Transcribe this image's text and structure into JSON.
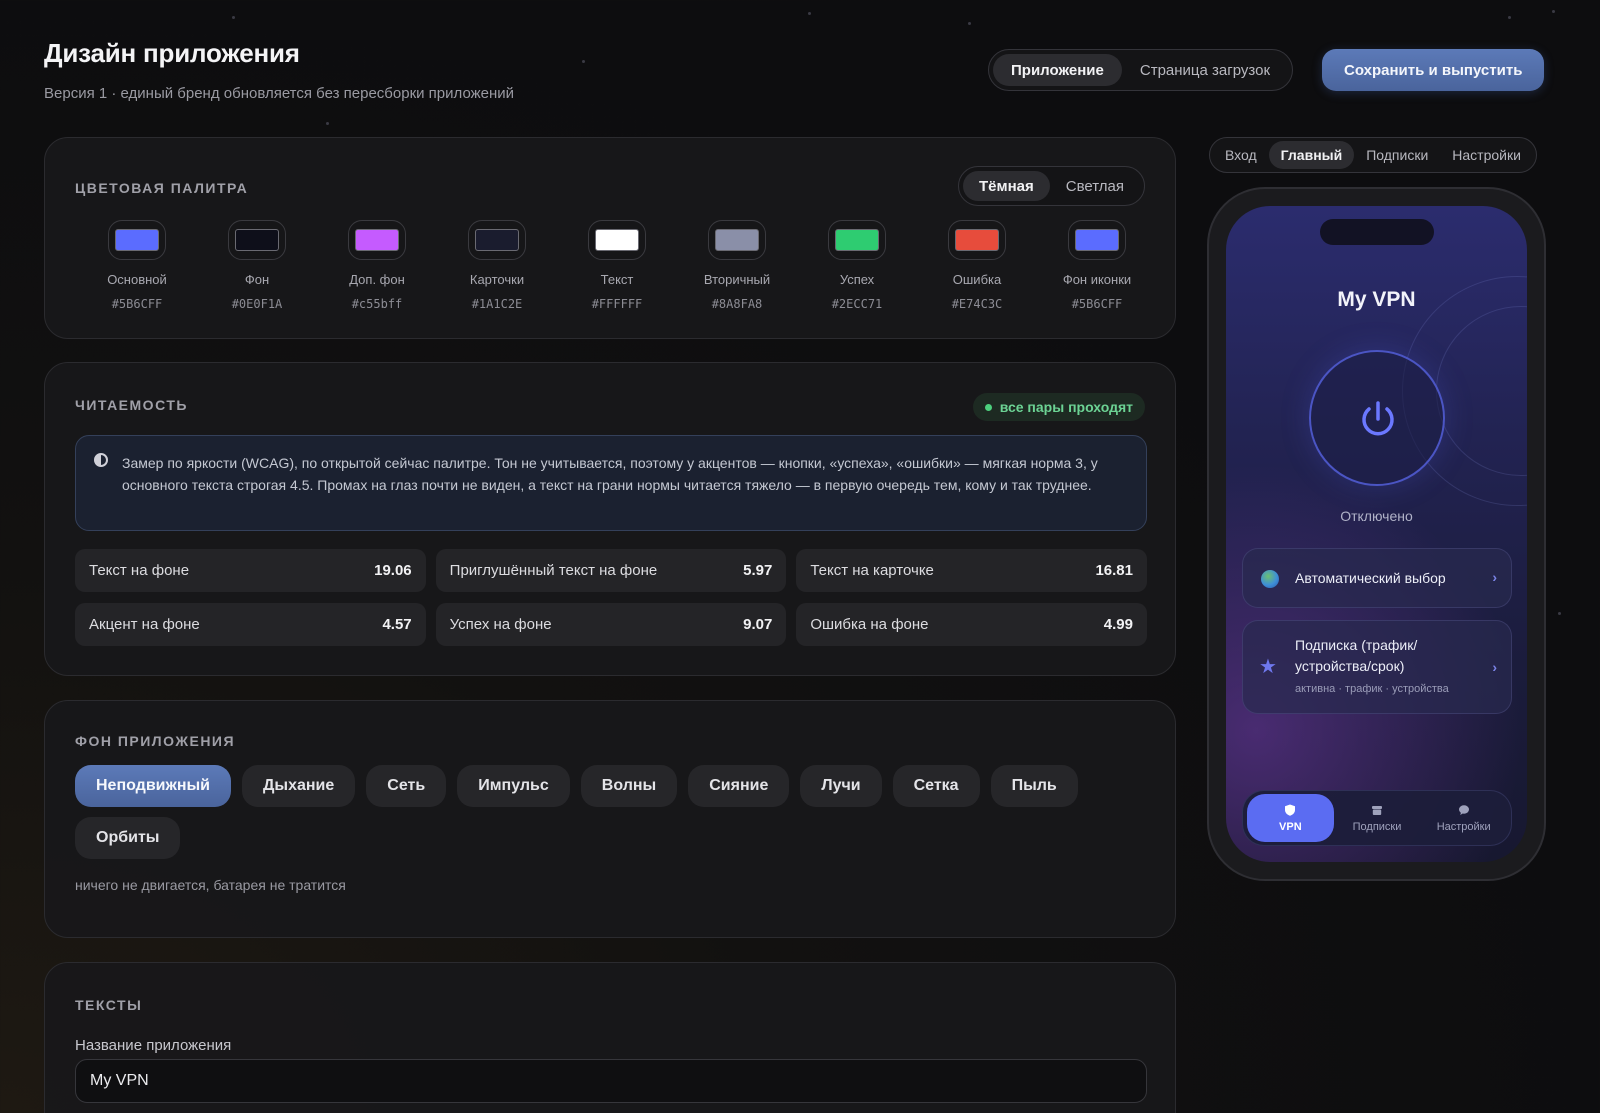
{
  "header": {
    "title": "Дизайн приложения",
    "subtitle": "Версия 1 · единый бренд обновляется без пересборки приложений"
  },
  "mode_tabs": [
    {
      "label": "Приложение",
      "active": true
    },
    {
      "label": "Страница загрузок",
      "active": false
    }
  ],
  "save_button": "Сохранить и выпустить",
  "palette": {
    "label": "ЦВЕТОВАЯ ПАЛИТРА",
    "theme_options": [
      {
        "label": "Тёмная",
        "active": true
      },
      {
        "label": "Светлая",
        "active": false
      }
    ],
    "swatches": [
      {
        "name": "Основной",
        "hex": "#5B6CFF"
      },
      {
        "name": "Фон",
        "hex": "#0E0F1A"
      },
      {
        "name": "Доп. фон",
        "hex": "#c55bff"
      },
      {
        "name": "Карточки",
        "hex": "#1A1C2E"
      },
      {
        "name": "Текст",
        "hex": "#FFFFFF"
      },
      {
        "name": "Вторичный",
        "hex": "#8A8FA8"
      },
      {
        "name": "Успех",
        "hex": "#2ECC71"
      },
      {
        "name": "Ошибка",
        "hex": "#E74C3C"
      },
      {
        "name": "Фон иконки",
        "hex": "#5B6CFF"
      }
    ]
  },
  "readability": {
    "label": "ЧИТАЕМОСТЬ",
    "badge": "все пары проходят",
    "info": "Замер по яркости (WCAG), по открытой сейчас палитре. Тон не учитывается, поэтому у акцентов — кнопки, «успеха», «ошибки» — мягкая норма 3, у основного текста строгая 4.5. Промах на глаз почти не виден, а текст на грани нормы читается тяжело — в первую очередь тем, кому и так труднее.",
    "metrics": [
      {
        "label": "Текст на фоне",
        "value": "19.06"
      },
      {
        "label": "Приглушённый текст на фоне",
        "value": "5.97"
      },
      {
        "label": "Текст на карточке",
        "value": "16.81"
      },
      {
        "label": "Акцент на фоне",
        "value": "4.57"
      },
      {
        "label": "Успех на фоне",
        "value": "9.07"
      },
      {
        "label": "Ошибка на фоне",
        "value": "4.99"
      }
    ]
  },
  "background": {
    "label": "ФОН ПРИЛОЖЕНИЯ",
    "options": [
      {
        "label": "Неподвижный",
        "active": true
      },
      {
        "label": "Дыхание",
        "active": false
      },
      {
        "label": "Сеть",
        "active": false
      },
      {
        "label": "Импульс",
        "active": false
      },
      {
        "label": "Волны",
        "active": false
      },
      {
        "label": "Сияние",
        "active": false
      },
      {
        "label": "Лучи",
        "active": false
      },
      {
        "label": "Сетка",
        "active": false
      },
      {
        "label": "Пыль",
        "active": false
      },
      {
        "label": "Орбиты",
        "active": false
      }
    ],
    "note": "ничего не двигается, батарея не тратится"
  },
  "texts": {
    "label": "ТЕКСТЫ",
    "app_name_label": "Название приложения",
    "app_name_value": "My VPN"
  },
  "preview_tabs": [
    {
      "label": "Вход",
      "active": false
    },
    {
      "label": "Главный",
      "active": true
    },
    {
      "label": "Подписки",
      "active": false
    },
    {
      "label": "Настройки",
      "active": false
    }
  ],
  "phone": {
    "app_title": "My VPN",
    "status": "Отключено",
    "server_row": "Автоматический выбор",
    "subscription_title": "Подписка (трафик/устройства/срок)",
    "subscription_sub": "активна · трафик · устройства",
    "tabs": [
      {
        "label": "VPN",
        "icon": "shield-icon",
        "active": true
      },
      {
        "label": "Подписки",
        "icon": "box-icon",
        "active": false
      },
      {
        "label": "Настройки",
        "icon": "chat-icon",
        "active": false
      }
    ]
  }
}
